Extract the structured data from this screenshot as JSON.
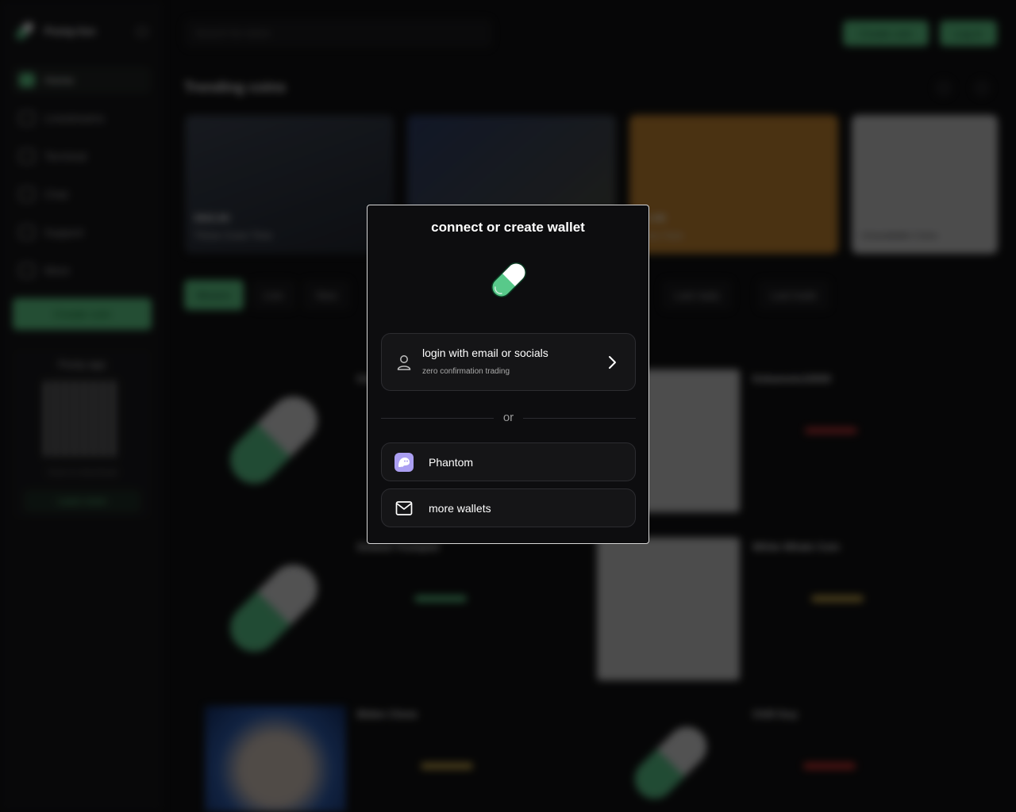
{
  "sidebar": {
    "brand": "Pump.fun",
    "nav": [
      "Home",
      "Livestreams",
      "Terminal",
      "Chat",
      "Support",
      "More"
    ],
    "create_label": "Create coin",
    "app_card": {
      "title": "Pump app",
      "caption": "Scan to download",
      "learn_label": "Learn more"
    }
  },
  "header": {
    "search_placeholder": "Search for token",
    "create_label": "Create coin",
    "login_label": "Log in"
  },
  "trending": {
    "title": "Trending coins",
    "cards": [
      {
        "mcap": "$562.8K",
        "name": "Thrive Cover Time"
      },
      {
        "mcap": "",
        "name": ""
      },
      {
        "mcap": "$1.4M",
        "name": "Deez Nuts"
      },
      {
        "mcap": "",
        "name": "Unavailable Coins"
      }
    ]
  },
  "tabs": [
    "Movers",
    "Live",
    "New",
    "Last reply",
    "Last trade"
  ],
  "coins": [
    {
      "name": "Kekfund"
    },
    {
      "name": "Doland Trumped"
    },
    {
      "name": "Biden Clone"
    },
    {
      "name": "Kekamoto10000"
    },
    {
      "name": "White Whale Coin"
    },
    {
      "name": "Chill Guy"
    }
  ],
  "modal": {
    "title": "connect or create wallet",
    "login_label": "login with email or socials",
    "login_sub": "zero confirmation trading",
    "divider": "or",
    "phantom_label": "Phantom",
    "more_label": "more wallets"
  },
  "colors": {
    "accent": "#5fd28a",
    "pill_green": "#58c98a",
    "phantom_purple": "#ab9ff2",
    "modal_border": "#d7d7d7"
  }
}
